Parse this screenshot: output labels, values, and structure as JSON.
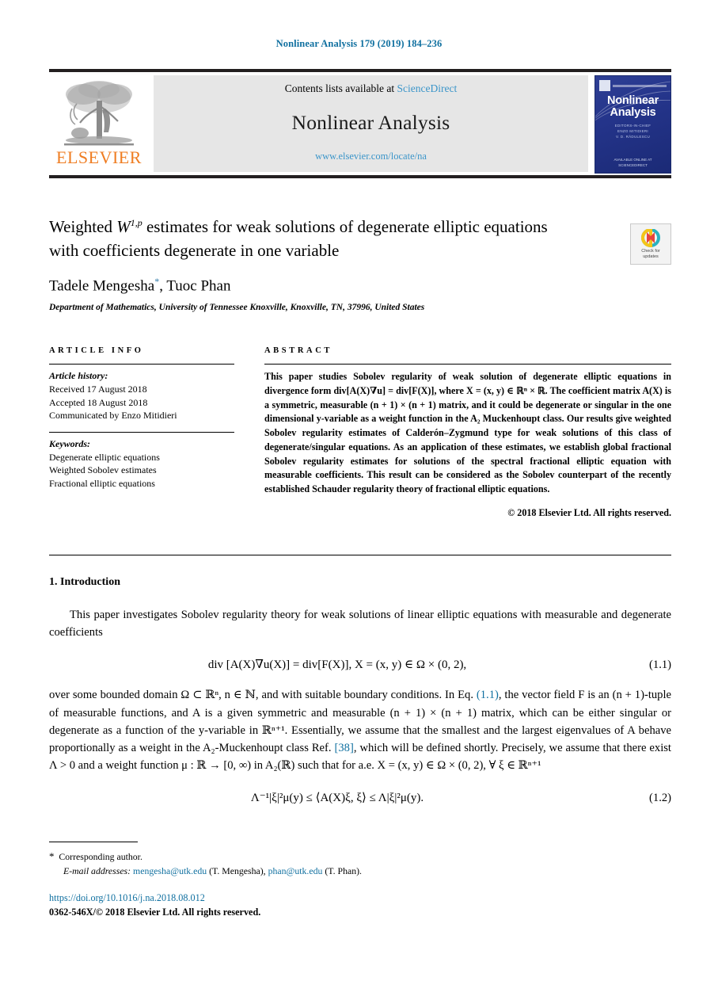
{
  "running_head": "Nonlinear Analysis 179 (2019) 184–236",
  "masthead": {
    "contents_prefix": "Contents lists available at ",
    "sciencedirect": "ScienceDirect",
    "journal_name": "Nonlinear Analysis",
    "journal_url": "www.elsevier.com/locate/na",
    "publisher_logo_text": "ELSEVIER",
    "cover": {
      "title_line1": "Nonlinear",
      "title_line2": "Analysis",
      "subtitle_line1": "EDITORS-IN-CHIEF",
      "subtitle_line2": "ENZO MITIDIERI",
      "subtitle_line3": "V. D. RĂDULESCU",
      "bottom_line1": "AVAILABLE ONLINE AT",
      "bottom_line2": "SCIENCEDIRECT"
    },
    "accent_link_color": "#3b95c9",
    "elsevier_orange": "#ef7d22"
  },
  "title": {
    "line1_pre": "Weighted ",
    "math": "W",
    "math_sup": "1,p",
    "line1_post": " estimates for weak solutions of degenerate elliptic",
    "line2": "equations with coefficients degenerate in one variable",
    "crossmark_line1": "Check for",
    "crossmark_line2": "updates"
  },
  "authors": {
    "names_pre": "Tadele Mengesha",
    "star": "*",
    "names_post": ", Tuoc Phan",
    "affiliation": "Department of Mathematics, University of Tennessee Knoxville, Knoxville, TN, 37996, United States"
  },
  "article_info": {
    "heading": "ARTICLE INFO",
    "history_head": "Article history:",
    "history": [
      "Received 17 August 2018",
      "Accepted 18 August 2018",
      "Communicated by Enzo Mitidieri"
    ],
    "keywords_head": "Keywords:",
    "keywords": [
      "Degenerate elliptic equations",
      "Weighted Sobolev estimates",
      "Fractional elliptic equations"
    ]
  },
  "abstract": {
    "heading": "ABSTRACT",
    "text_p1": "This paper studies Sobolev regularity of weak solution of degenerate elliptic equations in divergence form div[A(X)∇u] = div[F(X)], where X = (x, y) ∈ ℝⁿ × ℝ. The coefficient matrix A(X) is a symmetric, measurable (n + 1) × (n + 1) matrix, and it could be degenerate or singular in the one dimensional y-variable as a weight function in the A₂ Muckenhoupt class. Our results give weighted Sobolev regularity estimates of Calderón–Zygmund type for weak solutions of this class of degenerate/singular equations. As an application of these estimates, we establish global fractional Sobolev regularity estimates for solutions of the spectral fractional elliptic equation with measurable coefficients. This result can be considered as the Sobolev counterpart of the recently established Schauder regularity theory of fractional elliptic equations.",
    "copyright": "© 2018 Elsevier Ltd. All rights reserved."
  },
  "body": {
    "section_number_title": "1. Introduction",
    "para1": "This paper investigates Sobolev regularity theory for weak solutions of linear elliptic equations with measurable and degenerate coefficients",
    "eq1": "div [A(X)∇u(X)] = div[F(X)],    X = (x, y) ∈ Ω × (0, 2),",
    "eq1_num": "(1.1)",
    "para2_a": "over some bounded domain Ω ⊂ ℝⁿ, n ∈ ℕ, and with suitable boundary conditions. In Eq. ",
    "para2_link": "(1.1)",
    "para2_b": ", the vector field F is an (n + 1)-tuple of measurable functions, and A is a given symmetric and measurable (n + 1) × (n + 1) matrix, which can be either singular or degenerate as a function of the y-variable in ℝⁿ⁺¹. Essentially, we assume that the smallest and the largest eigenvalues of A behave proportionally as a weight in the A₂-Muckenhoupt class Ref. ",
    "para2_ref": "[38]",
    "para2_c": ", which will be defined shortly. Precisely, we assume that there exist Λ > 0 and a weight function μ : ℝ → [0, ∞) in A₂(ℝ) such that for a.e. X = (x, y) ∈ Ω × (0, 2), ∀ ξ ∈ ℝⁿ⁺¹",
    "eq2": "Λ⁻¹|ξ|²μ(y) ≤ ⟨A(X)ξ, ξ⟩ ≤ Λ|ξ|²μ(y).",
    "eq2_num": "(1.2)"
  },
  "footnotes": {
    "star": "*",
    "corresponding": "Corresponding author.",
    "email_label": "E-mail addresses:",
    "email1": "mengesha@utk.edu",
    "email1_owner": "(T. Mengesha),",
    "email2": "phan@utk.edu",
    "email2_owner": "(T. Phan)."
  },
  "doi": {
    "url_prefix": "https://doi.org/",
    "url_suffix": "10.1016/j.na.2018.08.012",
    "issn_line": "0362-546X/© 2018 Elsevier Ltd. All rights reserved."
  }
}
